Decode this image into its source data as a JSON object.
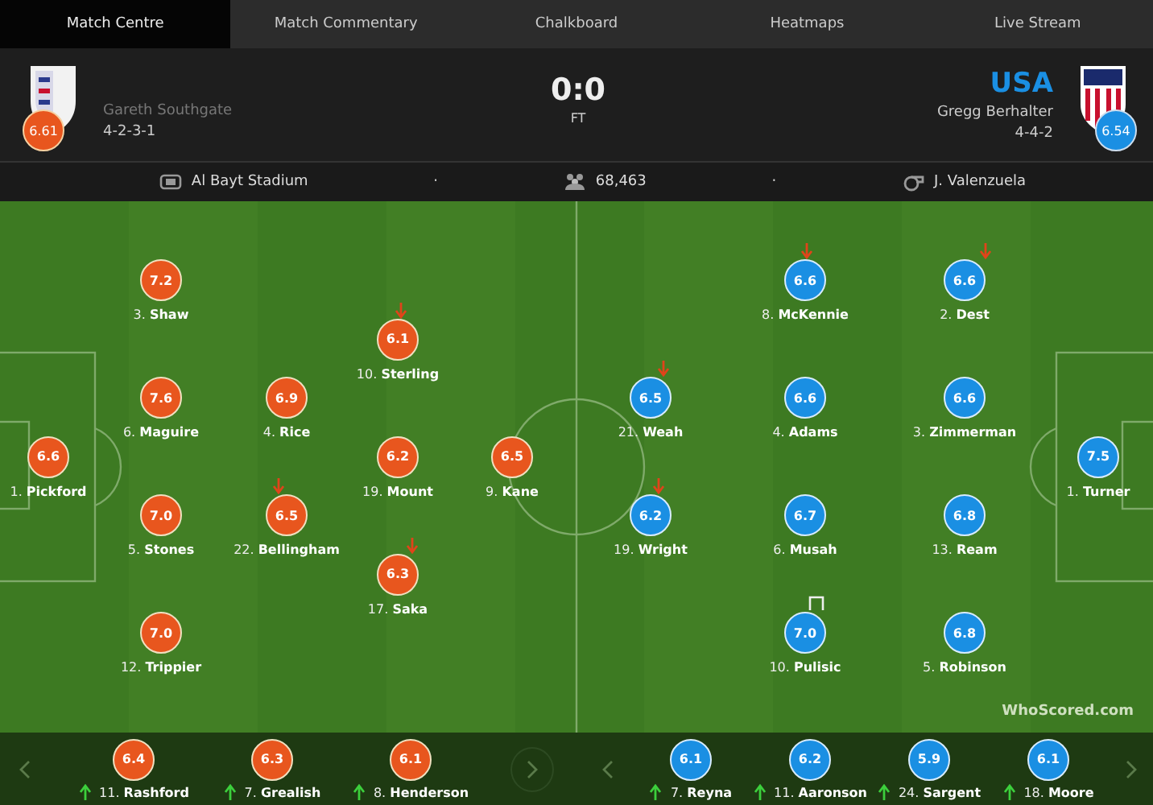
{
  "tabs": [
    {
      "label": "Match Centre",
      "selected": true
    },
    {
      "label": "Match Commentary",
      "selected": false
    },
    {
      "label": "Chalkboard",
      "selected": false
    },
    {
      "label": "Heatmaps",
      "selected": false
    },
    {
      "label": "Live Stream",
      "selected": false
    }
  ],
  "home": {
    "manager": "Gareth Southgate",
    "formation": "4-2-3-1",
    "rating": "6.61"
  },
  "away": {
    "name": "USA",
    "manager": "Gregg Berhalter",
    "formation": "4-4-2",
    "rating": "6.54"
  },
  "score": "0:0",
  "status": "FT",
  "info": [
    {
      "kind": "venue",
      "text": "Al Bayt Stadium"
    },
    {
      "kind": "separator",
      "text": "·"
    },
    {
      "kind": "attendance",
      "text": "68,463"
    },
    {
      "kind": "separator",
      "text": "·"
    },
    {
      "kind": "referee",
      "text": "J. Valenzuela"
    }
  ],
  "pitch": {
    "home_lines": [
      [
        {
          "number": "1.",
          "name": "Pickford",
          "rating": "6.6",
          "subbed_off": false,
          "woodwork": false
        }
      ],
      [
        {
          "number": "3.",
          "name": "Shaw",
          "rating": "7.2",
          "subbed_off": false,
          "woodwork": false
        },
        {
          "number": "6.",
          "name": "Maguire",
          "rating": "7.6",
          "subbed_off": false,
          "woodwork": false
        },
        {
          "number": "5.",
          "name": "Stones",
          "rating": "7.0",
          "subbed_off": false,
          "woodwork": false
        },
        {
          "number": "12.",
          "name": "Trippier",
          "rating": "7.0",
          "subbed_off": false,
          "woodwork": false
        }
      ],
      [
        {
          "number": "4.",
          "name": "Rice",
          "rating": "6.9",
          "subbed_off": false,
          "woodwork": false
        },
        {
          "number": "22.",
          "name": "Bellingham",
          "rating": "6.5",
          "subbed_off": true,
          "woodwork": false
        }
      ],
      [
        {
          "number": "10.",
          "name": "Sterling",
          "rating": "6.1",
          "subbed_off": true,
          "woodwork": false
        },
        {
          "number": "19.",
          "name": "Mount",
          "rating": "6.2",
          "subbed_off": false,
          "woodwork": false
        },
        {
          "number": "17.",
          "name": "Saka",
          "rating": "6.3",
          "subbed_off": true,
          "woodwork": false
        }
      ],
      [
        {
          "number": "9.",
          "name": "Kane",
          "rating": "6.5",
          "subbed_off": false,
          "woodwork": false
        }
      ]
    ],
    "away_lines": [
      [
        {
          "number": "21.",
          "name": "Weah",
          "rating": "6.5",
          "subbed_off": true,
          "woodwork": false
        },
        {
          "number": "19.",
          "name": "Wright",
          "rating": "6.2",
          "subbed_off": true,
          "woodwork": false
        }
      ],
      [
        {
          "number": "8.",
          "name": "McKennie",
          "rating": "6.6",
          "subbed_off": true,
          "woodwork": false
        },
        {
          "number": "4.",
          "name": "Adams",
          "rating": "6.6",
          "subbed_off": false,
          "woodwork": false
        },
        {
          "number": "6.",
          "name": "Musah",
          "rating": "6.7",
          "subbed_off": false,
          "woodwork": false
        },
        {
          "number": "10.",
          "name": "Pulisic",
          "rating": "7.0",
          "subbed_off": false,
          "woodwork": true
        }
      ],
      [
        {
          "number": "2.",
          "name": "Dest",
          "rating": "6.6",
          "subbed_off": true,
          "woodwork": false
        },
        {
          "number": "3.",
          "name": "Zimmerman",
          "rating": "6.6",
          "subbed_off": false,
          "woodwork": false
        },
        {
          "number": "13.",
          "name": "Ream",
          "rating": "6.8",
          "subbed_off": false,
          "woodwork": false
        },
        {
          "number": "5.",
          "name": "Robinson",
          "rating": "6.8",
          "subbed_off": false,
          "woodwork": false
        }
      ],
      [
        {
          "number": "1.",
          "name": "Turner",
          "rating": "7.5",
          "subbed_off": false,
          "woodwork": false
        }
      ]
    ],
    "logo": "WhoScored.com"
  },
  "subs": {
    "home": [
      {
        "number": "11.",
        "name": "Rashford",
        "rating": "6.4"
      },
      {
        "number": "7.",
        "name": "Grealish",
        "rating": "6.3"
      },
      {
        "number": "8.",
        "name": "Henderson",
        "rating": "6.1"
      }
    ],
    "away": [
      {
        "number": "7.",
        "name": "Reyna",
        "rating": "6.1"
      },
      {
        "number": "11.",
        "name": "Aaronson",
        "rating": "6.2"
      },
      {
        "number": "24.",
        "name": "Sargent",
        "rating": "5.9"
      },
      {
        "number": "18.",
        "name": "Moore",
        "rating": "6.1"
      }
    ]
  }
}
